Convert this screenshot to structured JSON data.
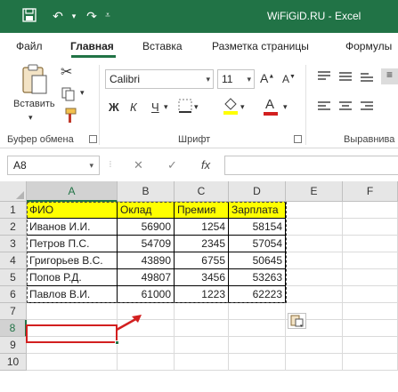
{
  "app": {
    "title": "WiFiGiD.RU  -  Excel",
    "accent": "#217346"
  },
  "tabs": [
    "Файл",
    "Главная",
    "Вставка",
    "Разметка страницы",
    "Формулы"
  ],
  "ribbon": {
    "paste_label": "Вставить",
    "font_name": "Calibri",
    "font_size": "11",
    "bold": "Ж",
    "italic": "К",
    "underline": "Ч",
    "groups": {
      "clipboard": "Буфер обмена",
      "font": "Шрифт",
      "alignment": "Выравнива"
    }
  },
  "formula_bar": {
    "name_box": "A8",
    "fx": "fx",
    "value": ""
  },
  "sheet": {
    "columns": [
      "A",
      "B",
      "C",
      "D",
      "E",
      "F"
    ],
    "rows": [
      "1",
      "2",
      "3",
      "4",
      "5",
      "6",
      "7",
      "8",
      "9",
      "10"
    ],
    "header": [
      "ФИО",
      "Оклад",
      "Премия",
      "Зарплата"
    ],
    "data": [
      [
        "Иванов И.И.",
        "56900",
        "1254",
        "58154"
      ],
      [
        "Петров П.С.",
        "54709",
        "2345",
        "57054"
      ],
      [
        "Григорьев В.С.",
        "43890",
        "6755",
        "50645"
      ],
      [
        "Попов Р.Д.",
        "49807",
        "3456",
        "53263"
      ],
      [
        "Павлов В.И.",
        "61000",
        "1223",
        "62223"
      ]
    ],
    "highlight_color": "#ffff00",
    "annotation_color": "#d21f1f"
  }
}
